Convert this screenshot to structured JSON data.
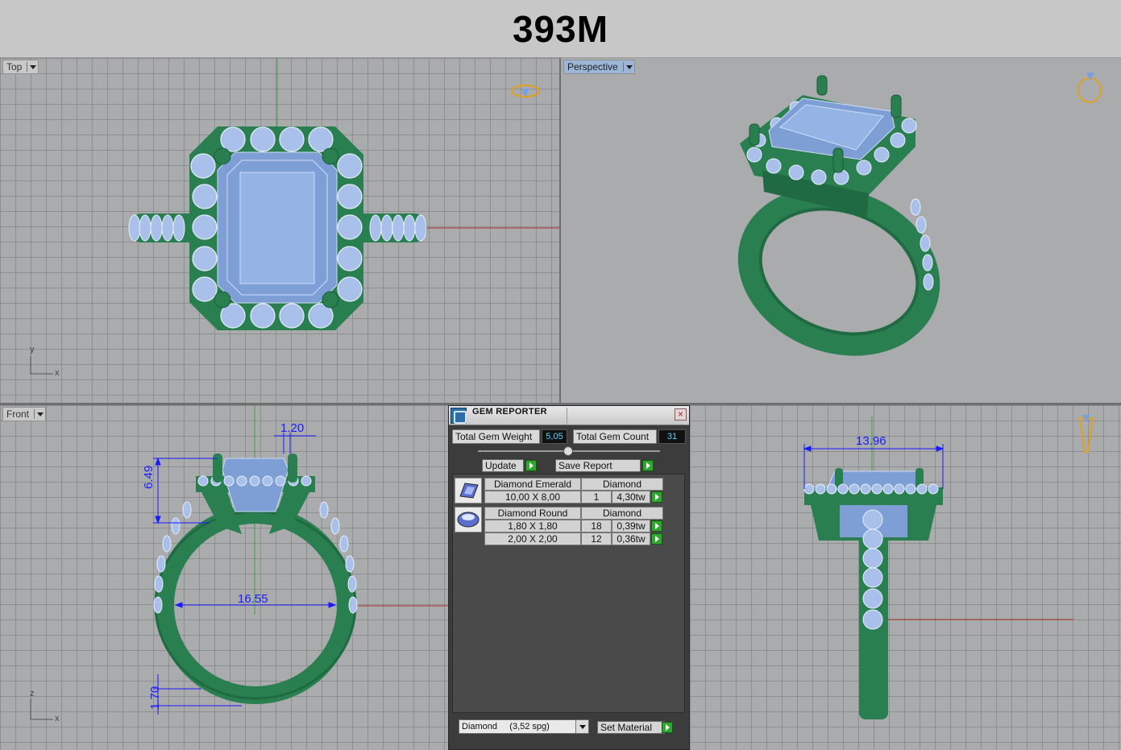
{
  "title": "393M",
  "viewports": {
    "top": {
      "label": "Top",
      "axis_x": "x",
      "axis_y": "y"
    },
    "perspective": {
      "label": "Perspective"
    },
    "front": {
      "label": "Front",
      "axis_x": "x",
      "axis_z": "z",
      "dimensions": {
        "prong": "1.20",
        "height": "6.49",
        "inner_diameter": "16.55",
        "band": "1.70"
      }
    },
    "right": {
      "dimensions": {
        "width": "13.96"
      }
    }
  },
  "gem_reporter": {
    "title": "GEM REPORTER",
    "close_glyph": "×",
    "total_weight_label": "Total Gem Weight",
    "total_weight_value": "5,05",
    "total_count_label": "Total Gem Count",
    "total_count_value": "31",
    "update_label": "Update",
    "save_report_label": "Save Report",
    "groups": [
      {
        "name": "Diamond Emerald",
        "material": "Diamond",
        "rows": [
          {
            "size": "10,00 X 8,00",
            "count": "1",
            "weight": "4,30tw"
          }
        ]
      },
      {
        "name": "Diamond Round",
        "material": "Diamond",
        "rows": [
          {
            "size": "1,80 X 1,80",
            "count": "18",
            "weight": "0,39tw"
          },
          {
            "size": "2,00 X 2,00",
            "count": "12",
            "weight": "0,36tw"
          }
        ]
      }
    ],
    "material_select": "Diamond     (3,52 spg)",
    "set_material_label": "Set Material"
  },
  "colors": {
    "metal": "#2a7f50",
    "gem": "#8fb2e6",
    "dimension": "#1a1aff",
    "axis_x": "#b03030",
    "axis_y": "#3aa03a"
  }
}
